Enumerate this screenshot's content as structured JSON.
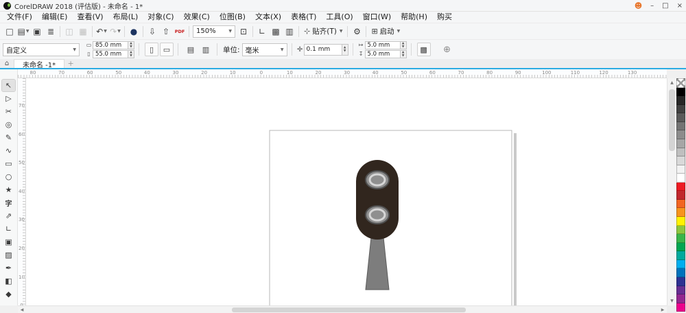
{
  "window": {
    "title": "CorelDRAW 2018 (评估版) - 未命名 - 1*",
    "account_glyph": "☻",
    "minimize": "–",
    "maximize": "□",
    "close": "×"
  },
  "menubar": {
    "items": [
      "文件(F)",
      "编辑(E)",
      "查看(V)",
      "布局(L)",
      "对象(C)",
      "效果(C)",
      "位图(B)",
      "文本(X)",
      "表格(T)",
      "工具(O)",
      "窗口(W)",
      "帮助(H)",
      "购买"
    ]
  },
  "toolbar": {
    "items": [
      {
        "type": "btn",
        "name": "new-document-button",
        "glyph": "□"
      },
      {
        "type": "btn",
        "name": "open-button",
        "glyph": "▤",
        "caret": true
      },
      {
        "type": "btn",
        "name": "save-button",
        "glyph": "▣"
      },
      {
        "type": "btn",
        "name": "print-button",
        "glyph": "≣"
      },
      {
        "type": "sep"
      },
      {
        "type": "btn",
        "name": "copy-button",
        "glyph": "◫",
        "disabled": true
      },
      {
        "type": "btn",
        "name": "paste-button",
        "glyph": "▦",
        "disabled": true
      },
      {
        "type": "sep"
      },
      {
        "type": "btn",
        "name": "undo-button",
        "glyph": "↶",
        "caret": true
      },
      {
        "type": "btn",
        "name": "redo-button",
        "glyph": "↷",
        "caret": true,
        "disabled": true
      },
      {
        "type": "sep"
      },
      {
        "type": "btn",
        "name": "search-content-button",
        "glyph": "●",
        "color": "#1d3461"
      },
      {
        "type": "sep"
      },
      {
        "type": "btn",
        "name": "import-button",
        "glyph": "⇩"
      },
      {
        "type": "btn",
        "name": "export-button",
        "glyph": "⇧"
      },
      {
        "type": "btn",
        "name": "publish-pdf-button",
        "glyph": "PDF"
      },
      {
        "type": "sep"
      },
      {
        "type": "combo",
        "name": "zoom-level-combo",
        "value": "150%"
      },
      {
        "type": "btn",
        "name": "fullscreen-preview-button",
        "glyph": "⊡"
      },
      {
        "type": "sep"
      },
      {
        "type": "btn",
        "name": "show-rulers-button",
        "glyph": "∟"
      },
      {
        "type": "btn",
        "name": "show-grid-button",
        "glyph": "▩"
      },
      {
        "type": "btn",
        "name": "show-guidelines-button",
        "glyph": "▥"
      },
      {
        "type": "sep"
      },
      {
        "type": "labelbtn",
        "name": "snap-to-button",
        "glyph": "⊹",
        "label": "贴齐(T)",
        "caret": true
      },
      {
        "type": "sep"
      },
      {
        "type": "btn",
        "name": "options-button",
        "glyph": "⚙"
      },
      {
        "type": "sep"
      },
      {
        "type": "labelbtn",
        "name": "launch-button",
        "glyph": "⊞",
        "label": "启动",
        "caret": true
      }
    ]
  },
  "property_bar": {
    "preset": "自定义",
    "page_width": "85.0 mm",
    "page_height": "55.0 mm",
    "width_icon": "▭",
    "height_icon": "▯",
    "portrait_glyph": "▯",
    "landscape_glyph": "▭",
    "all_pages_glyph": "▤",
    "current_page_glyph": "▥",
    "units_label": "单位:",
    "units": "毫米",
    "nudge_icon": "✛",
    "nudge": "0.1 mm",
    "dup_x_icon": "↦",
    "dup_y_icon": "↧",
    "duplicate_x": "5.0 mm",
    "duplicate_y": "5.0 mm",
    "treat_filled_glyph": "▩",
    "launcher_glyph": "⊕"
  },
  "tabbar": {
    "home_glyph": "⌂",
    "tab_label": "未命名 -1*",
    "new_tab_glyph": "+"
  },
  "rulers": {
    "horizontal": {
      "start": 22,
      "spacing": 41.6,
      "labels": [
        "80",
        "70",
        "60",
        "50",
        "40",
        "30",
        "20",
        "10",
        "0",
        "10",
        "20",
        "30",
        "40",
        "50",
        "60",
        "70",
        "80",
        "90",
        "100",
        "110",
        "120",
        "130"
      ]
    },
    "vertical": {
      "start": 40,
      "spacing": 41.6,
      "labels": [
        "70",
        "60",
        "50",
        "40",
        "30",
        "20",
        "10",
        "0"
      ]
    }
  },
  "toolbox": {
    "tools": [
      {
        "name": "pick-tool",
        "glyph": "↖",
        "active": true
      },
      {
        "name": "shape-tool",
        "glyph": "▷"
      },
      {
        "name": "crop-tool",
        "glyph": "✂"
      },
      {
        "name": "zoom-tool",
        "glyph": "◎"
      },
      {
        "name": "freehand-tool",
        "glyph": "✎"
      },
      {
        "name": "artistic-media-tool",
        "glyph": "∿"
      },
      {
        "name": "rectangle-tool",
        "glyph": "▭"
      },
      {
        "name": "ellipse-tool",
        "glyph": "○"
      },
      {
        "name": "polygon-tool",
        "glyph": "★"
      },
      {
        "name": "text-tool",
        "glyph": "字",
        "cjk": true
      },
      {
        "name": "dimension-tool",
        "glyph": "⇗"
      },
      {
        "name": "connector-tool",
        "glyph": "∟"
      },
      {
        "name": "drop-shadow-tool",
        "glyph": "▣"
      },
      {
        "name": "transparency-tool",
        "glyph": "▨"
      },
      {
        "name": "eyedropper-tool",
        "glyph": "✒"
      },
      {
        "name": "interactive-fill-tool",
        "glyph": "◧"
      },
      {
        "name": "smart-fill-tool",
        "glyph": "◆"
      }
    ]
  },
  "palette": {
    "colors": [
      "#000000",
      "#262626",
      "#404040",
      "#595959",
      "#737373",
      "#8c8c8c",
      "#a6a6a6",
      "#bfbfbf",
      "#d9d9d9",
      "#f2f2f2",
      "#ffffff",
      "#ed1c24",
      "#c1272d",
      "#f26522",
      "#f7941d",
      "#fff200",
      "#8dc63f",
      "#39b54a",
      "#00a651",
      "#00a99d",
      "#00aeef",
      "#0072bc",
      "#2e3192",
      "#662d91",
      "#92278f",
      "#ec008c"
    ]
  },
  "scroll": {
    "up": "▲",
    "down": "▼",
    "left": "◀",
    "right": "▶"
  },
  "artwork": {
    "page_fill": "#ffffff",
    "page_stroke": "#b7b7b7",
    "page_shadow": "#c9c9c9",
    "body_color": "#31261e",
    "light_fill": "#8f8f8f",
    "light_stroke": "#4f4f4f",
    "ring_color": "#d6d6d6",
    "pole_fill": "#7d7d7d",
    "pole_stroke": "#5c5c5c"
  }
}
